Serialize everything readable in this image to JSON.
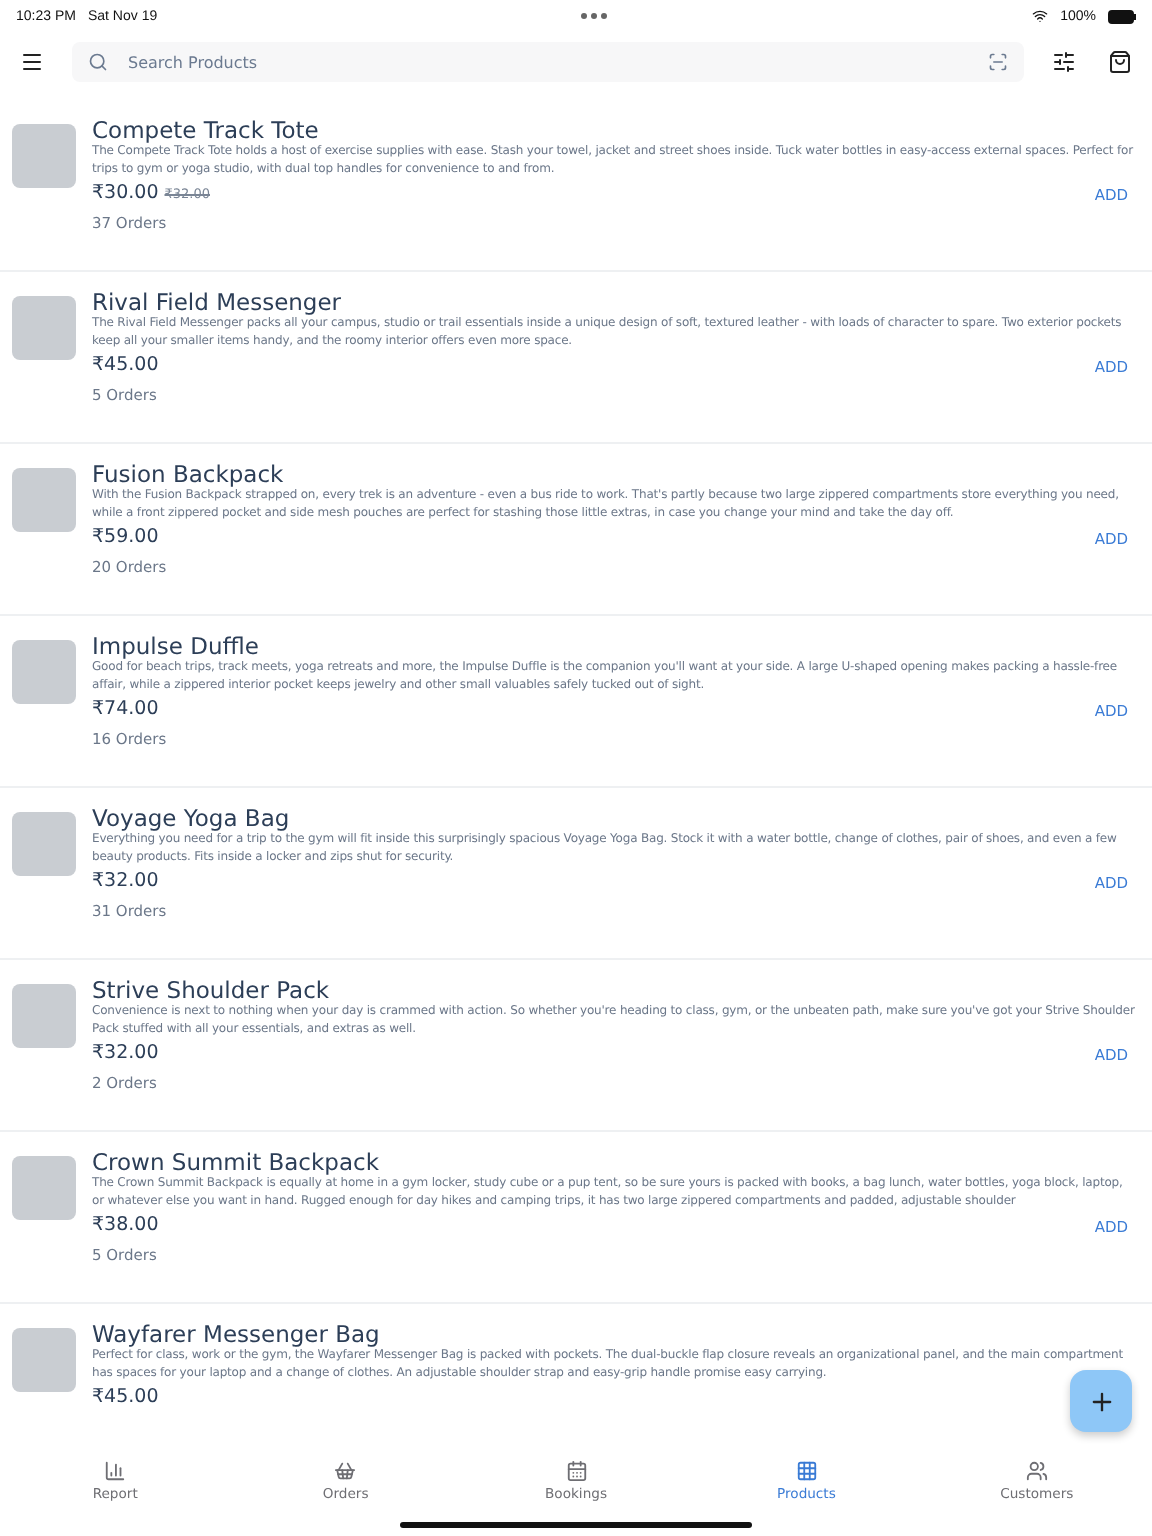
{
  "status_bar": {
    "time": "10:23 PM",
    "date": "Sat Nov 19",
    "battery": "100%"
  },
  "search": {
    "placeholder": "Search Products"
  },
  "products": [
    {
      "name": "Compete Track Tote",
      "description": "The Compete Track Tote holds a host of exercise supplies with ease. Stash your towel, jacket and street shoes inside. Tuck water bottles in easy-access external spaces. Perfect for trips to gym or yoga studio, with dual top handles for convenience to and from.",
      "price": "₹30.00",
      "old_price": "₹32.00",
      "orders": "37 Orders",
      "action": "ADD"
    },
    {
      "name": "Rival Field Messenger",
      "description": "The Rival Field Messenger packs all your campus, studio or trail essentials inside a unique design of soft, textured leather - with loads of character to spare. Two exterior pockets keep all your smaller items handy, and the roomy interior offers even more space.",
      "price": "₹45.00",
      "orders": "5 Orders",
      "action": "ADD"
    },
    {
      "name": "Fusion Backpack",
      "description": "With the Fusion Backpack strapped on, every trek is an adventure - even a bus ride to work. That's partly because two large zippered compartments store everything you need, while a front zippered pocket and side mesh pouches are perfect for stashing those little extras, in case you change your mind and take the day off.",
      "price": "₹59.00",
      "orders": "20 Orders",
      "action": "ADD"
    },
    {
      "name": "Impulse Duffle",
      "description": "Good for beach trips, track meets, yoga retreats and more, the Impulse Duffle is the companion you'll want at your side. A large U-shaped opening makes packing a hassle-free affair, while a zippered interior pocket keeps jewelry and other small valuables safely tucked out of sight.",
      "price": "₹74.00",
      "orders": "16 Orders",
      "action": "ADD"
    },
    {
      "name": "Voyage Yoga Bag",
      "description": "Everything you need for a trip to the gym will fit inside this surprisingly spacious Voyage Yoga Bag. Stock it with a water bottle, change of clothes, pair of shoes, and even a few beauty products. Fits inside a locker and zips shut for security.",
      "price": "₹32.00",
      "orders": "31 Orders",
      "action": "ADD"
    },
    {
      "name": "Strive Shoulder Pack",
      "description": "Convenience is next to nothing when your day is crammed with action. So whether you're heading to class, gym, or the unbeaten path, make sure you've got your Strive Shoulder Pack stuffed with all your essentials, and extras as well.",
      "price": "₹32.00",
      "orders": "2 Orders",
      "action": "ADD"
    },
    {
      "name": "Crown Summit Backpack",
      "description": "The Crown Summit Backpack is equally at home in a gym locker, study cube or a pup tent, so be sure yours is packed with books, a bag lunch, water bottles, yoga block, laptop, or whatever else you want in hand. Rugged enough for day hikes and camping trips, it has two large zippered compartments and padded, adjustable shoulder",
      "price": "₹38.00",
      "orders": "5 Orders",
      "action": "ADD"
    },
    {
      "name": "Wayfarer Messenger Bag",
      "description": "Perfect for class, work or the gym, the Wayfarer Messenger Bag is packed with pockets. The dual-buckle flap closure reveals an organizational panel, and the main compartment has spaces for your laptop and a change of clothes. An adjustable shoulder strap and easy-grip handle promise easy carrying.",
      "price": "₹45.00"
    }
  ],
  "tabs": [
    {
      "label": "Report",
      "kind": "report",
      "selected": false
    },
    {
      "label": "Orders",
      "kind": "orders",
      "selected": false
    },
    {
      "label": "Bookings",
      "kind": "bookings",
      "selected": false
    },
    {
      "label": "Products",
      "kind": "products",
      "selected": true
    },
    {
      "label": "Customers",
      "kind": "customers",
      "selected": false
    }
  ]
}
